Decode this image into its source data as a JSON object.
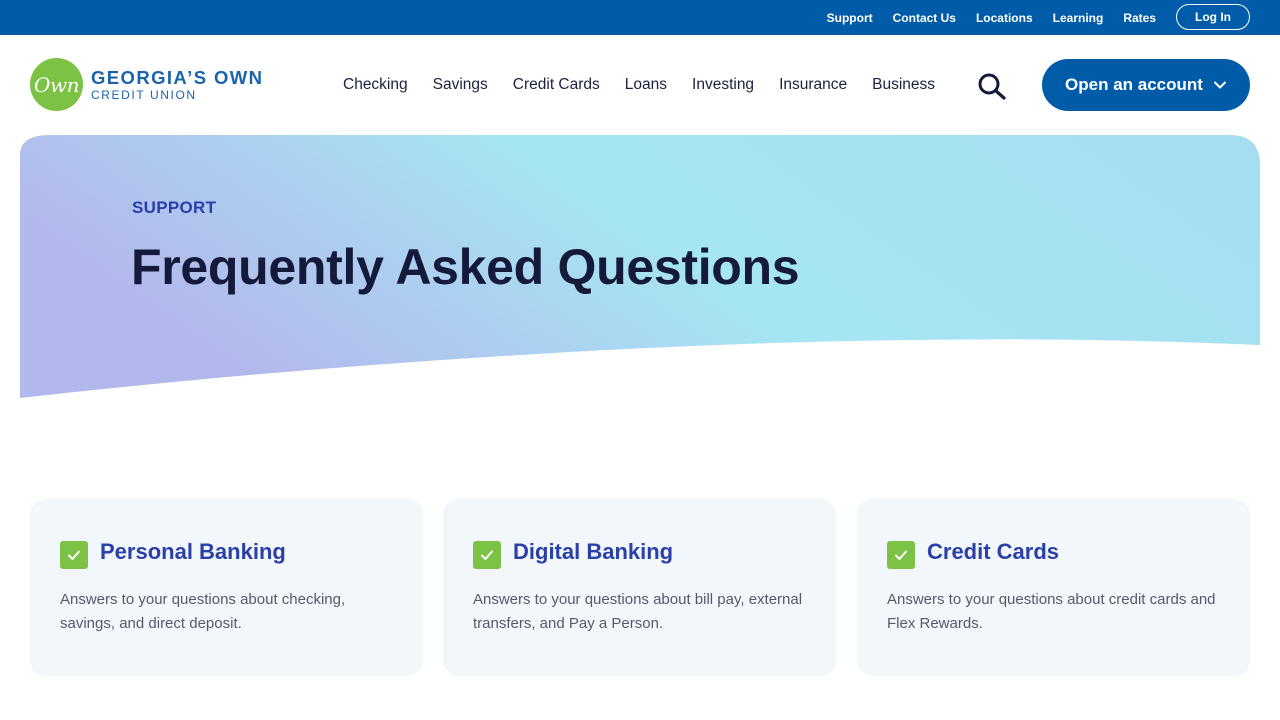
{
  "utility_nav": {
    "links": [
      "Support",
      "Contact Us",
      "Locations",
      "Learning",
      "Rates"
    ],
    "login_label": "Log In"
  },
  "brand": {
    "mark_text": "Own",
    "name_line1": "GEORGIA’S OWN",
    "name_line2": "CREDIT UNION"
  },
  "main_nav": {
    "items": [
      "Checking",
      "Savings",
      "Credit Cards",
      "Loans",
      "Investing",
      "Insurance",
      "Business"
    ],
    "search_icon": "search-icon",
    "cta_label": "Open an account"
  },
  "hero": {
    "eyebrow": "SUPPORT",
    "title": "Frequently Asked Questions"
  },
  "cards": [
    {
      "title": "Personal Banking",
      "description": "Answers to your questions about checking, savings, and direct deposit.",
      "icon": "check-icon"
    },
    {
      "title": "Digital Banking",
      "description": "Answers to your questions about bill pay, external transfers, and Pay a Person.",
      "icon": "check-icon"
    },
    {
      "title": "Credit Cards",
      "description": "Answers to your questions about credit cards and Flex Rewards.",
      "icon": "check-icon"
    }
  ],
  "colors": {
    "primary_blue": "#005ca8",
    "brand_green": "#7cc245",
    "heading_blue": "#2a3fa8",
    "card_bg": "#f2f7fc"
  }
}
